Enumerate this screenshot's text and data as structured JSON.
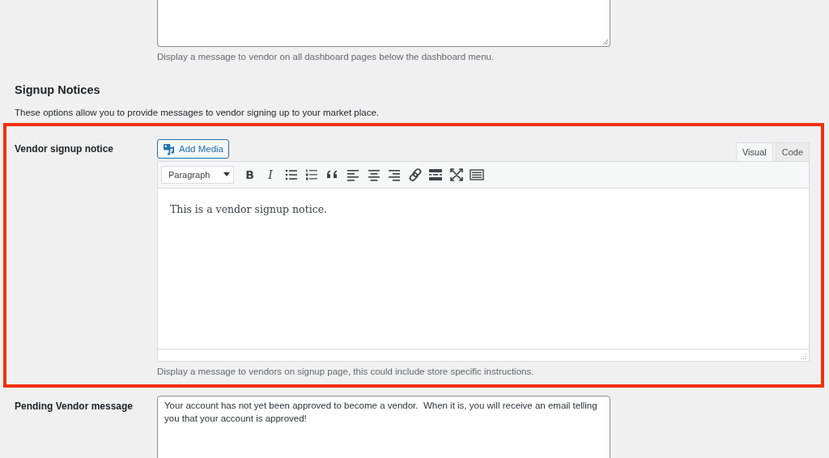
{
  "dashboard_message": {
    "hint": "Display a message to vendor on all dashboard pages below the dashboard menu."
  },
  "section": {
    "title": "Signup Notices",
    "description": "These options allow you to provide messages to vendor signing up to your market place."
  },
  "signup_notice": {
    "label": "Vendor signup notice",
    "highlighted": true,
    "add_media": "Add Media",
    "tabs": [
      {
        "label": "Visual",
        "selected": true
      },
      {
        "label": "Code",
        "selected": false
      }
    ],
    "format": "Paragraph",
    "toolbar": [
      {
        "kind": "bold",
        "label": "B"
      },
      {
        "kind": "italic",
        "label": "I"
      },
      {
        "kind": "bullets"
      },
      {
        "kind": "numbers"
      },
      {
        "kind": "quote"
      },
      {
        "kind": "align-left"
      },
      {
        "kind": "align-center"
      },
      {
        "kind": "align-right"
      },
      {
        "kind": "link"
      },
      {
        "kind": "more"
      },
      {
        "kind": "fullscreen"
      },
      {
        "kind": "keyboard"
      }
    ],
    "content": "This is a vendor signup notice.",
    "hint": "Display a message to vendors on signup page, this could include store specific instructions."
  },
  "pending_message": {
    "label": "Pending Vendor message",
    "value": "Your account has not yet been approved to become a vendor.  When it is, you will receive an email telling you that your account is approved!"
  }
}
